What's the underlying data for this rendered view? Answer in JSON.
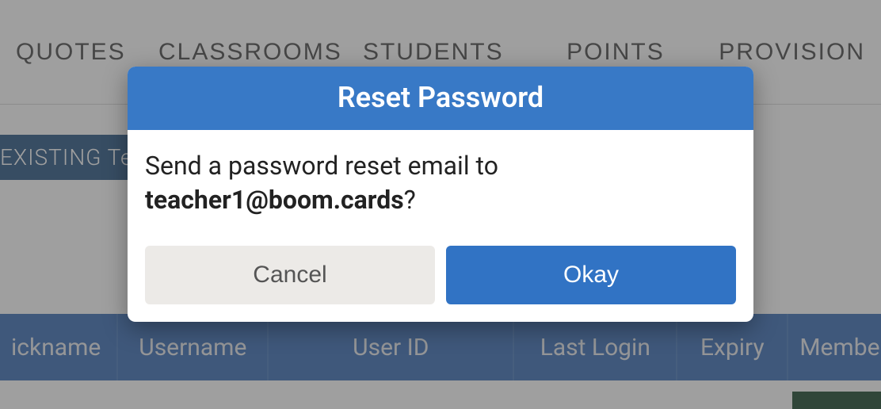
{
  "tabs": {
    "quotes": "QUOTES",
    "classrooms": "CLASSROOMS",
    "students": "STUDENTS",
    "points": "POINTS",
    "provision": "PROVISION "
  },
  "buttons": {
    "existing": "EXISTING Tea"
  },
  "columns": {
    "nickname": "ickname",
    "username": "Username",
    "userid": "User ID",
    "lastlogin": "Last Login",
    "expiry": "Expiry",
    "member": "Membe"
  },
  "modal": {
    "title": "Reset Password",
    "prompt_before": "Send a password reset email to ",
    "prompt_email": "teacher1@boom.cards",
    "prompt_after": "?",
    "cancel": "Cancel",
    "okay": "Okay"
  }
}
